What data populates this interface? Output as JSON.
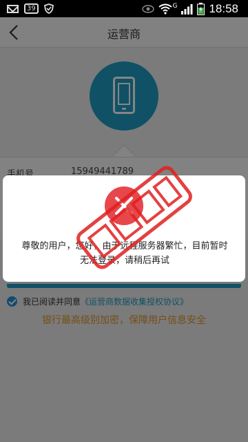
{
  "status_bar": {
    "time": "18:58",
    "badge": "39",
    "network_letter": "G",
    "icons": [
      "mail-icon",
      "badge-39-icon",
      "shield-icon",
      "eye-icon",
      "wifi-icon",
      "signal-icon",
      "battery-icon"
    ]
  },
  "header": {
    "title": "运营商",
    "back_icon": "chevron-left-icon"
  },
  "hero": {
    "icon": "mobile-phone-icon",
    "color": "#1f9bc3"
  },
  "form": {
    "phone_label": "手机号",
    "phone_value": "15949441789"
  },
  "agreement": {
    "prefix": "我已阅读并同意",
    "link": "《运营商数据收集授权协议》",
    "checked": true
  },
  "security_note": "银行最高级别加密，保障用户信息安全",
  "dialog": {
    "icon": "error-x-icon",
    "message": "尊敬的用户，您好，由于远程服务器繁忙，目前暂时无法登录，请稍后再试"
  },
  "colors": {
    "accent": "#1f9bc3",
    "error": "#e7474b",
    "notice": "#e0962b"
  }
}
